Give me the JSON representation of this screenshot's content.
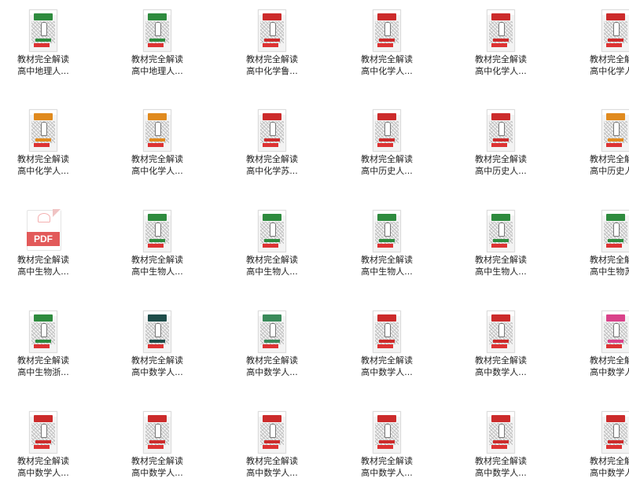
{
  "files": [
    {
      "line1": "教材完全解读",
      "line2": "高中地理人...",
      "thumb": "book",
      "accent": "#2e8b3e"
    },
    {
      "line1": "教材完全解读",
      "line2": "高中地理人...",
      "thumb": "book",
      "accent": "#2e8b3e"
    },
    {
      "line1": "教材完全解读",
      "line2": "高中化学鲁...",
      "thumb": "book",
      "accent": "#cc2b2b"
    },
    {
      "line1": "教材完全解读",
      "line2": "高中化学人...",
      "thumb": "book",
      "accent": "#cc2b2b"
    },
    {
      "line1": "教材完全解读",
      "line2": "高中化学人...",
      "thumb": "book",
      "accent": "#cc2b2b"
    },
    {
      "line1": "教材完全解读",
      "line2": "高中化学人...",
      "thumb": "book",
      "accent": "#cc2b2b"
    },
    {
      "line1": "教材完全解读",
      "line2": "高中化学人...",
      "thumb": "book",
      "accent": "#e08a1e"
    },
    {
      "line1": "教材完全解读",
      "line2": "高中化学人...",
      "thumb": "book",
      "accent": "#e08a1e"
    },
    {
      "line1": "教材完全解读",
      "line2": "高中化学苏...",
      "thumb": "book",
      "accent": "#cc2b2b"
    },
    {
      "line1": "教材完全解读",
      "line2": "高中历史人...",
      "thumb": "book",
      "accent": "#cc2b2b"
    },
    {
      "line1": "教材完全解读",
      "line2": "高中历史人...",
      "thumb": "book",
      "accent": "#cc2b2b"
    },
    {
      "line1": "教材完全解读",
      "line2": "高中历史人...",
      "thumb": "book",
      "accent": "#e08a1e"
    },
    {
      "line1": "教材完全解读",
      "line2": "高中生物人...",
      "thumb": "pdf",
      "accent": "#e25a5a",
      "pdf_label": "PDF"
    },
    {
      "line1": "教材完全解读",
      "line2": "高中生物人...",
      "thumb": "book",
      "accent": "#2e8b3e"
    },
    {
      "line1": "教材完全解读",
      "line2": "高中生物人...",
      "thumb": "book",
      "accent": "#2e8b3e"
    },
    {
      "line1": "教材完全解读",
      "line2": "高中生物人...",
      "thumb": "book",
      "accent": "#2e8b3e"
    },
    {
      "line1": "教材完全解读",
      "line2": "高中生物人...",
      "thumb": "book",
      "accent": "#2e8b3e"
    },
    {
      "line1": "教材完全解读",
      "line2": "高中生物苏...",
      "thumb": "book",
      "accent": "#2e8b3e"
    },
    {
      "line1": "教材完全解读",
      "line2": "高中生物浙...",
      "thumb": "book",
      "accent": "#2e8b3e"
    },
    {
      "line1": "教材完全解读",
      "line2": "高中数学人...",
      "thumb": "book",
      "accent": "#1f4d4a"
    },
    {
      "line1": "教材完全解读",
      "line2": "高中数学人...",
      "thumb": "book",
      "accent": "#3a8a5a"
    },
    {
      "line1": "教材完全解读",
      "line2": "高中数学人...",
      "thumb": "book",
      "accent": "#cc2b2b"
    },
    {
      "line1": "教材完全解读",
      "line2": "高中数学人...",
      "thumb": "book",
      "accent": "#cc2b2b"
    },
    {
      "line1": "教材完全解读",
      "line2": "高中数学人...",
      "thumb": "book",
      "accent": "#d9428a"
    },
    {
      "line1": "教材完全解读",
      "line2": "高中数学人...",
      "thumb": "book",
      "accent": "#cc2b2b"
    },
    {
      "line1": "教材完全解读",
      "line2": "高中数学人...",
      "thumb": "book",
      "accent": "#cc2b2b"
    },
    {
      "line1": "教材完全解读",
      "line2": "高中数学人...",
      "thumb": "book",
      "accent": "#cc2b2b"
    },
    {
      "line1": "教材完全解读",
      "line2": "高中数学人...",
      "thumb": "book",
      "accent": "#cc2b2b"
    },
    {
      "line1": "教材完全解读",
      "line2": "高中数学人...",
      "thumb": "book",
      "accent": "#cc2b2b"
    },
    {
      "line1": "教材完全解读",
      "line2": "高中数学人...",
      "thumb": "book",
      "accent": "#cc2b2b"
    }
  ]
}
